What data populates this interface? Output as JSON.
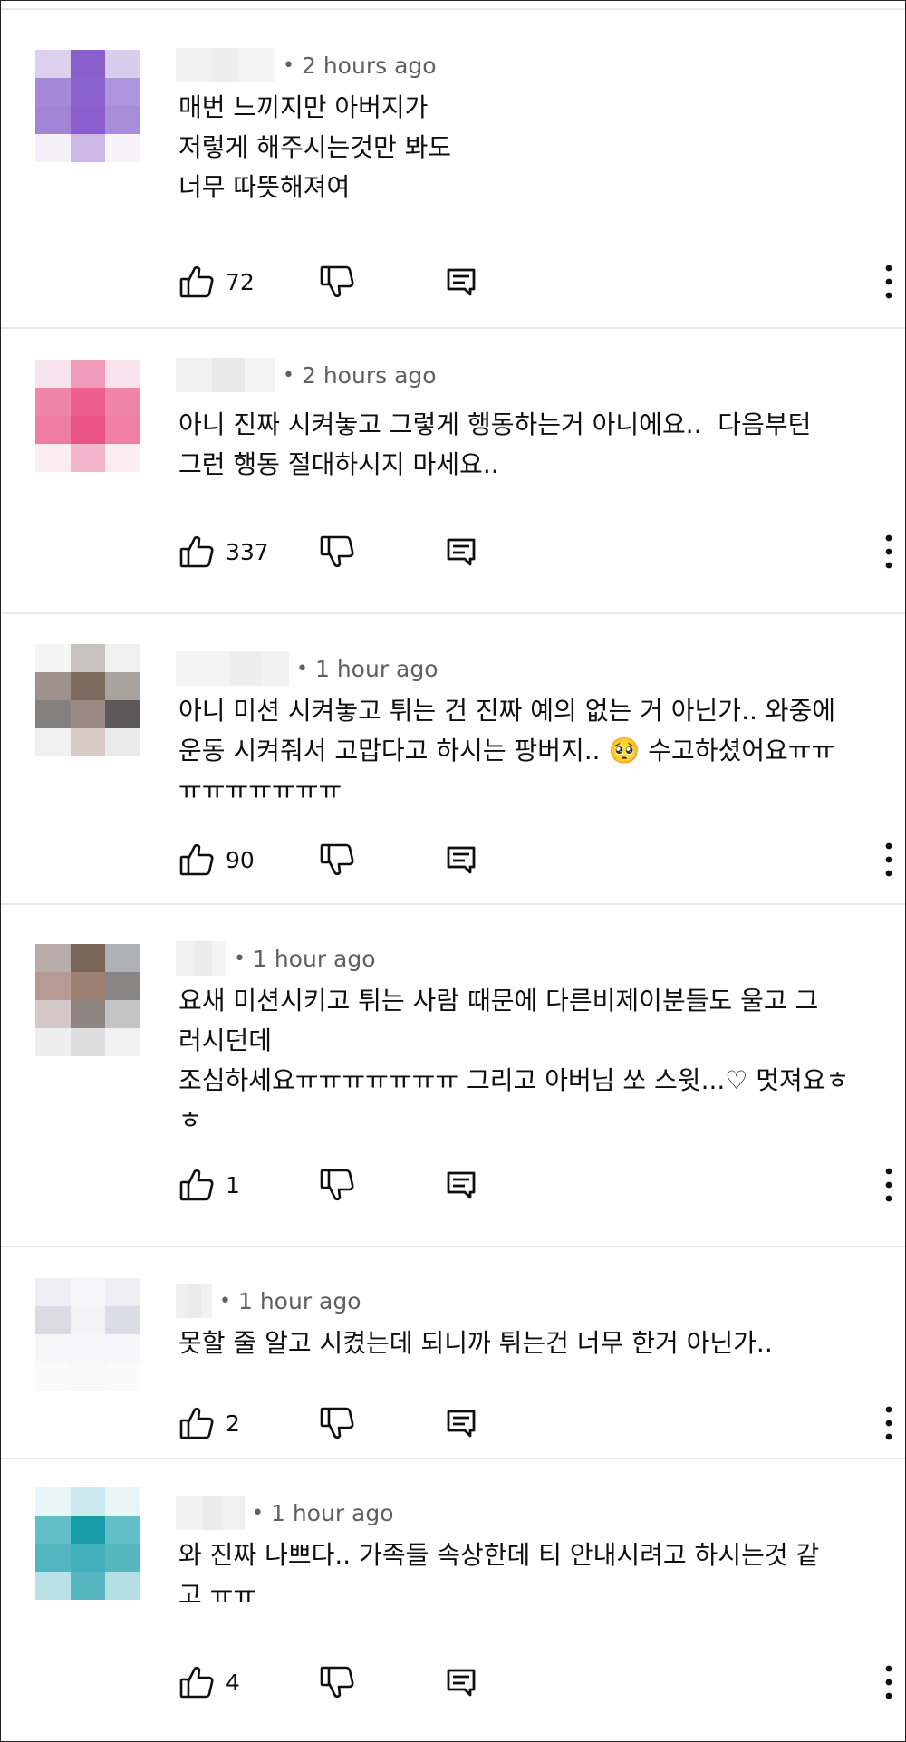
{
  "comments": [
    {
      "time": "2 hours ago",
      "text": "매번 느끼지만 아버지가\n저렇게 해주시는것만 봐도\n너무 따뜻해져여",
      "likes": "72",
      "avatar": [
        "#ddd0ef",
        "#8b5fcb",
        "#d7cdec",
        "#a689d9",
        "#8c62cf",
        "#ae95dd",
        "#a286d5",
        "#8a5ecc",
        "#a88ed8",
        "#f4f0f8",
        "#ccb8e6",
        "#f6f3f9"
      ],
      "name_blur": [
        "#f2f2f2",
        "#eeeeee",
        "#f4f4f4"
      ]
    },
    {
      "time": "2 hours ago",
      "text": "아니 진짜 시켜놓고 그렇게 행동하는거 아니에요..  다음부턴\n그런 행동 절대하시지 마세요..",
      "likes": "337",
      "avatar": [
        "#f8e4ee",
        "#f199b9",
        "#f8e3ed",
        "#ef85a9",
        "#ed5f8e",
        "#ef86aa",
        "#ef7ca3",
        "#ea5386",
        "#f07ea5",
        "#fbeef3",
        "#f4b5cc",
        "#fbecf2"
      ],
      "name_blur": [
        "#f0f0f0",
        "#e8e8e8",
        "#f3f3f3"
      ]
    },
    {
      "time": "1 hour ago",
      "text": "아니 미션 시켜놓고 튀는 건 진짜 예의 없는 거 아닌가.. 와중에\n운동 시켜줘서 고맙다고 하시는 팡버지.. 🥺 수고하셨어요ㅠㅠ\nㅠㅠㅠㅠㅠㅠㅠ",
      "likes": "90",
      "avatar": [
        "#f5f5f5",
        "#c7c1bf",
        "#f0f0f0",
        "#9f928c",
        "#7e6c61",
        "#aaa29d",
        "#838080",
        "#9a8a83",
        "#5d595a",
        "#f1f1f1",
        "#d8cbc3",
        "#ebeaea"
      ],
      "name_blur": [
        "#f4f4f4",
        "#eeeeee",
        "#f2f2f2"
      ]
    },
    {
      "time": "1 hour ago",
      "text": "요새 미션시키고 튀는 사람 때문에 다른비제이분들도 울고 그\n러시던데\n조심하세요ㅠㅠㅠㅠㅠㅠㅠ 그리고 아버님 쏘 스윗...♡ 멋져요ㅎ\nㅎ",
      "likes": "1",
      "avatar": [
        "#b9adac",
        "#786459",
        "#afb2b5",
        "#b89a94",
        "#9e8174",
        "#888584",
        "#d4c9c8",
        "#8f8682",
        "#c5c4c4",
        "#eeeeee",
        "#dddddd",
        "#f1f1f1"
      ],
      "name_blur": [
        "#f1f1f1",
        "#ebebeb",
        "#f5f5f5"
      ]
    },
    {
      "time": "1 hour ago",
      "text": "못할 줄 알고 시켰는데 되니까 튀는건 너무 한거 아닌가..",
      "likes": "2",
      "avatar": [
        "#efeff3",
        "#f6f6f8",
        "#efeff3",
        "#dbdae3",
        "#f3f3f6",
        "#dcdce6",
        "#f7f7f9",
        "#f6f6f8",
        "#f7f7fa",
        "#fafafa",
        "#f8f8f8",
        "#fafafa"
      ],
      "name_blur": [
        "#efefef",
        "#eaeaea",
        "#f2f2f2"
      ]
    },
    {
      "time": "1 hour ago",
      "text": "와 진짜 나쁘다.. 가족들 속상한데 티 안내시려고 하시는것 같\n고 ㅠㅠ",
      "likes": "4",
      "avatar": [
        "#e8f6f7",
        "#cbebef",
        "#e9f6f7",
        "#62bec8",
        "#169da7",
        "#62bfc9",
        "#52b5bf",
        "#41b0ba",
        "#56b7c1",
        "#b8e2e7",
        "#57b7c1",
        "#b4e0e5"
      ],
      "name_blur": [
        "#f1f1f1",
        "#ebebeb",
        "#f1f1f1"
      ]
    }
  ],
  "icons": {
    "like": "thumbs-up-icon",
    "dislike": "thumbs-down-icon",
    "reply": "reply-comment-icon",
    "more": "more-vertical-icon"
  }
}
